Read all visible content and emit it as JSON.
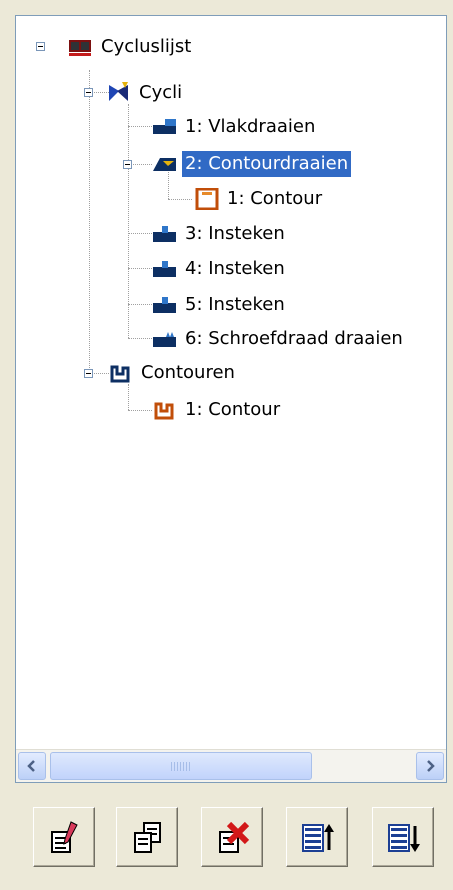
{
  "tree": {
    "root": {
      "label": "Cycluslijst",
      "icon": "flag-icon"
    },
    "cycli_group": {
      "label": "Cycli",
      "icon": "cycles-icon"
    },
    "cycles": [
      {
        "label": "1: Vlakdraaien",
        "icon": "facing-icon"
      },
      {
        "label": "2: Contourdraaien",
        "icon": "contour-turning-icon",
        "selected": true
      },
      {
        "label": "3: Insteken",
        "icon": "grooving-icon"
      },
      {
        "label": "4: Insteken",
        "icon": "grooving-icon"
      },
      {
        "label": "5: Insteken",
        "icon": "grooving-icon"
      },
      {
        "label": "6: Schroefdraad draaien",
        "icon": "thread-icon"
      }
    ],
    "cycle2_child": {
      "label": "1: Contour",
      "icon": "contour-square-icon"
    },
    "contouren_group": {
      "label": "Contouren",
      "icon": "contour-profile-icon"
    },
    "contours": [
      {
        "label": "1: Contour",
        "icon": "contour-profile-icon"
      }
    ]
  },
  "colors": {
    "selection": "#316ac5",
    "panel_border": "#7f9db9",
    "background": "#ece9d8"
  },
  "toolbar": [
    {
      "name": "edit-button",
      "icon": "edit-icon"
    },
    {
      "name": "copy-button",
      "icon": "copy-icon"
    },
    {
      "name": "delete-button",
      "icon": "delete-icon"
    },
    {
      "name": "move-up-button",
      "icon": "move-up-icon"
    },
    {
      "name": "move-down-button",
      "icon": "move-down-icon"
    }
  ]
}
